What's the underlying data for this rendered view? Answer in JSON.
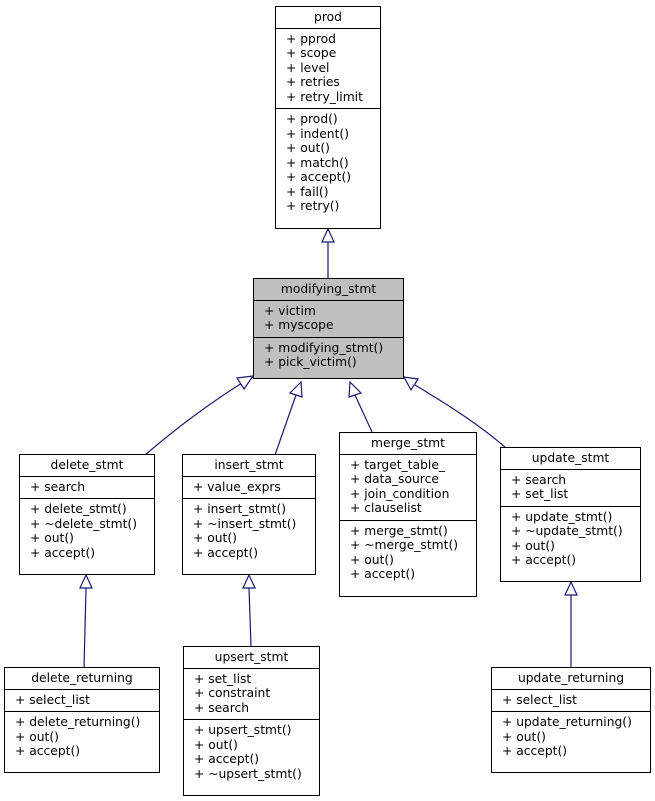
{
  "colors": {
    "edge": "#191970",
    "highlight_fill": "#bfbfbf",
    "box_fill": "#ffffff",
    "border": "#000000"
  },
  "classes": {
    "prod": {
      "name": "prod",
      "attributes": [
        "+ pprod",
        "+ scope",
        "+ level",
        "+ retries",
        "+ retry_limit"
      ],
      "methods": [
        "+ prod()",
        "+ indent()",
        "+ out()",
        "+ match()",
        "+ accept()",
        "+ fail()",
        "+ retry()"
      ]
    },
    "modifying_stmt": {
      "name": "modifying_stmt",
      "attributes": [
        "+ victim",
        "+ myscope"
      ],
      "methods": [
        "+ modifying_stmt()",
        "+ pick_victim()"
      ]
    },
    "delete_stmt": {
      "name": "delete_stmt",
      "attributes": [
        "+ search"
      ],
      "methods": [
        "+ delete_stmt()",
        "+ ~delete_stmt()",
        "+ out()",
        "+ accept()"
      ]
    },
    "insert_stmt": {
      "name": "insert_stmt",
      "attributes": [
        "+ value_exprs"
      ],
      "methods": [
        "+ insert_stmt()",
        "+ ~insert_stmt()",
        "+ out()",
        "+ accept()"
      ]
    },
    "merge_stmt": {
      "name": "merge_stmt",
      "attributes": [
        "+ target_table_",
        "+ data_source",
        "+ join_condition",
        "+ clauselist"
      ],
      "methods": [
        "+ merge_stmt()",
        "+ ~merge_stmt()",
        "+ out()",
        "+ accept()"
      ]
    },
    "update_stmt": {
      "name": "update_stmt",
      "attributes": [
        "+ search",
        "+ set_list"
      ],
      "methods": [
        "+ update_stmt()",
        "+ ~update_stmt()",
        "+ out()",
        "+ accept()"
      ]
    },
    "delete_returning": {
      "name": "delete_returning",
      "attributes": [
        "+ select_list"
      ],
      "methods": [
        "+ delete_returning()",
        "+ out()",
        "+ accept()"
      ]
    },
    "upsert_stmt": {
      "name": "upsert_stmt",
      "attributes": [
        "+ set_list",
        "+ constraint",
        "+ search"
      ],
      "methods": [
        "+ upsert_stmt()",
        "+ out()",
        "+ accept()",
        "+ ~upsert_stmt()"
      ]
    },
    "update_returning": {
      "name": "update_returning",
      "attributes": [
        "+ select_list"
      ],
      "methods": [
        "+ update_returning()",
        "+ out()",
        "+ accept()"
      ]
    }
  },
  "inheritance": [
    {
      "child": "modifying_stmt",
      "parent": "prod"
    },
    {
      "child": "delete_stmt",
      "parent": "modifying_stmt"
    },
    {
      "child": "insert_stmt",
      "parent": "modifying_stmt"
    },
    {
      "child": "merge_stmt",
      "parent": "modifying_stmt"
    },
    {
      "child": "update_stmt",
      "parent": "modifying_stmt"
    },
    {
      "child": "delete_returning",
      "parent": "delete_stmt"
    },
    {
      "child": "upsert_stmt",
      "parent": "insert_stmt"
    },
    {
      "child": "update_returning",
      "parent": "update_stmt"
    }
  ]
}
